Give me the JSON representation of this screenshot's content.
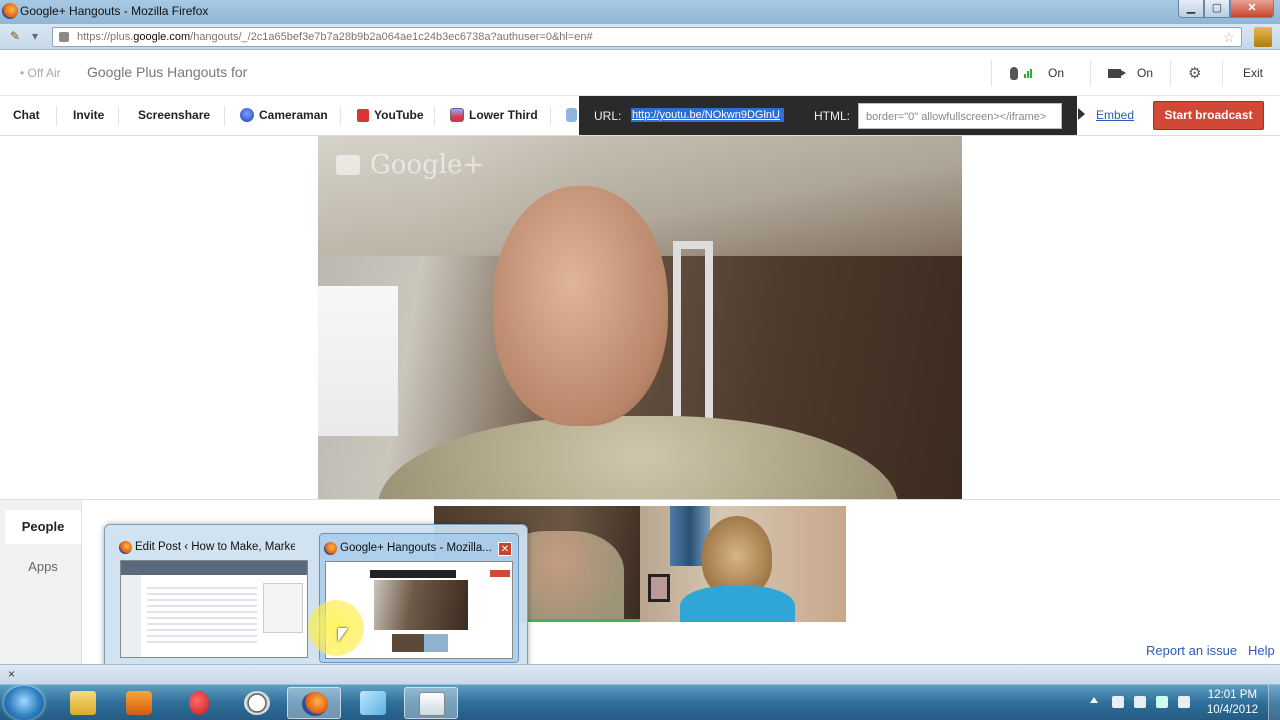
{
  "browser": {
    "window_title": "Google+ Hangouts - Mozilla Firefox",
    "url_prefix": "https://plus.",
    "url_domain": "google.com",
    "url_rest": "/hangouts/_/2c1a65bef3e7b7a28b9b2a064ae1c24b3ec6738a?authuser=0&hl=en#"
  },
  "hangout": {
    "status": "• Off Air",
    "title": "Google Plus Hangouts for",
    "mic_label": "On",
    "camera_label": "On",
    "exit_label": "Exit"
  },
  "toolbar": {
    "chat": "Chat",
    "invite": "Invite",
    "screenshare": "Screenshare",
    "cameraman": "Cameraman",
    "youtube": "YouTube",
    "lower_third": "Lower Third"
  },
  "broadcast": {
    "url_label": "URL:",
    "url_value": "http://youtu.be/NOkwn9DGlnU",
    "html_label": "HTML:",
    "html_value": "border=\"0\" allowfullscreen></iframe>",
    "embed_label": "Embed",
    "start_label": "Start broadcast"
  },
  "video": {
    "watermark": "Google+"
  },
  "side_tabs": {
    "people": "People",
    "apps": "Apps"
  },
  "taskbar_preview": {
    "item1_title": "Edit Post ‹ How to Make, Marke...",
    "item2_title": "Google+ Hangouts - Mozilla..."
  },
  "footer": {
    "report": "Report an issue",
    "help": "Help"
  },
  "statusbar": {
    "close_glyph": "×"
  },
  "system_tray": {
    "time": "12:01 PM",
    "date": "10/4/2012"
  },
  "colors": {
    "start_broadcast": "#d14836",
    "link": "#2a5db0",
    "url_highlight": "#2d6fd4"
  }
}
